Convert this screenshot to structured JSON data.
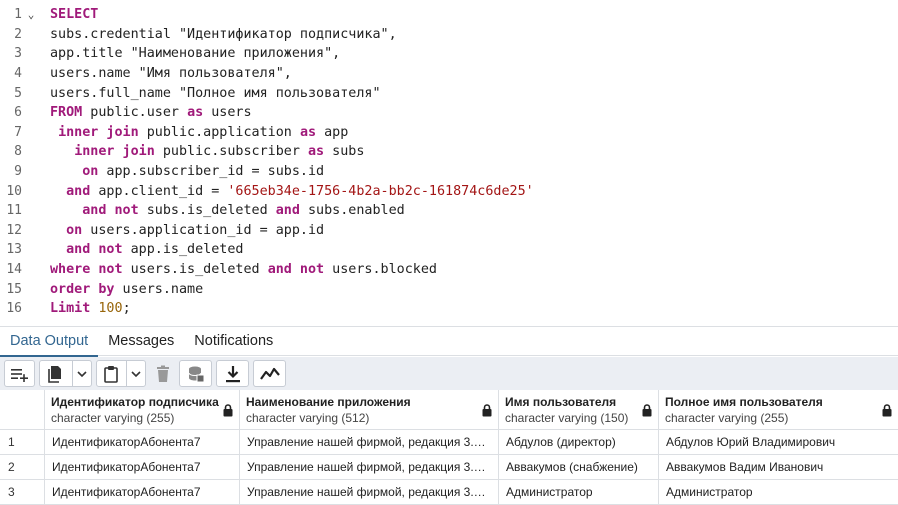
{
  "editor": {
    "line_numbers": [
      "1",
      "2",
      "3",
      "4",
      "5",
      "6",
      "7",
      "8",
      "9",
      "10",
      "11",
      "12",
      "13",
      "14",
      "15",
      "16"
    ],
    "fold_marker": "⌄",
    "lines": [
      [
        {
          "t": "SELECT",
          "c": "kw"
        }
      ],
      [
        {
          "t": "subs.credential \"Идентификатор подписчика\","
        }
      ],
      [
        {
          "t": "app.title \"Наименование приложения\","
        }
      ],
      [
        {
          "t": "users.name \"Имя пользователя\","
        }
      ],
      [
        {
          "t": "users.full_name \"Полное имя пользователя\""
        }
      ],
      [
        {
          "t": "FROM",
          "c": "kw"
        },
        {
          "t": " public.user "
        },
        {
          "t": "as",
          "c": "kw"
        },
        {
          "t": " users"
        }
      ],
      [
        {
          "t": " "
        },
        {
          "t": "inner join",
          "c": "kw"
        },
        {
          "t": " public.application "
        },
        {
          "t": "as",
          "c": "kw"
        },
        {
          "t": " app"
        }
      ],
      [
        {
          "t": "   "
        },
        {
          "t": "inner join",
          "c": "kw"
        },
        {
          "t": " public.subscriber "
        },
        {
          "t": "as",
          "c": "kw"
        },
        {
          "t": " subs"
        }
      ],
      [
        {
          "t": "    "
        },
        {
          "t": "on",
          "c": "kw"
        },
        {
          "t": " app.subscriber_id = subs.id"
        }
      ],
      [
        {
          "t": "  "
        },
        {
          "t": "and",
          "c": "kw"
        },
        {
          "t": " app.client_id = "
        },
        {
          "t": "'665eb34e-1756-4b2a-bb2c-161874c6de25'",
          "c": "str"
        }
      ],
      [
        {
          "t": "    "
        },
        {
          "t": "and not",
          "c": "kw"
        },
        {
          "t": " subs.is_deleted "
        },
        {
          "t": "and",
          "c": "kw"
        },
        {
          "t": " subs.enabled"
        }
      ],
      [
        {
          "t": "  "
        },
        {
          "t": "on",
          "c": "kw"
        },
        {
          "t": " users.application_id = app.id"
        }
      ],
      [
        {
          "t": "  "
        },
        {
          "t": "and not",
          "c": "kw"
        },
        {
          "t": " app.is_deleted"
        }
      ],
      [
        {
          "t": "where not",
          "c": "kw"
        },
        {
          "t": " users.is_deleted "
        },
        {
          "t": "and not",
          "c": "kw"
        },
        {
          "t": " users.blocked"
        }
      ],
      [
        {
          "t": "order by",
          "c": "kw"
        },
        {
          "t": " users.name"
        }
      ],
      [
        {
          "t": "Limit",
          "c": "kw"
        },
        {
          "t": " "
        },
        {
          "t": "100",
          "c": "num"
        },
        {
          "t": ";"
        }
      ]
    ]
  },
  "tabs": [
    {
      "label": "Data Output",
      "active": true
    },
    {
      "label": "Messages",
      "active": false
    },
    {
      "label": "Notifications",
      "active": false
    }
  ],
  "toolbar": {
    "buttons": [
      "add-row-icon",
      "copy-icon",
      "chevron-down-icon",
      "paste-icon",
      "chevron-down-icon",
      "delete-icon",
      "save-data-icon",
      "download-icon",
      "graph-visualiser-icon"
    ]
  },
  "grid": {
    "columns": [
      {
        "name": "Идентификатор подписчика",
        "type": "character varying (255)"
      },
      {
        "name": "Наименование приложения",
        "type": "character varying (512)"
      },
      {
        "name": "Имя пользователя",
        "type": "character varying (150)"
      },
      {
        "name": "Полное имя пользователя",
        "type": "character varying (255)"
      }
    ],
    "rows": [
      {
        "n": "1",
        "cells": [
          "ИдентификаторАбонента7",
          "Управление нашей фирмой, редакция 3.…",
          "Абдулов (директор)",
          "Абдулов Юрий Владимирович"
        ]
      },
      {
        "n": "2",
        "cells": [
          "ИдентификаторАбонента7",
          "Управление нашей фирмой, редакция 3.…",
          "Аввакумов (снабжение)",
          "Аввакумов Вадим Иванович"
        ]
      },
      {
        "n": "3",
        "cells": [
          "ИдентификаторАбонента7",
          "Управление нашей фирмой, редакция 3.…",
          "Администратор",
          "Администратор"
        ]
      }
    ]
  },
  "colors": {
    "keyword": "#a01a7a",
    "string": "#a31515",
    "number": "#98660b",
    "accent": "#326690"
  }
}
